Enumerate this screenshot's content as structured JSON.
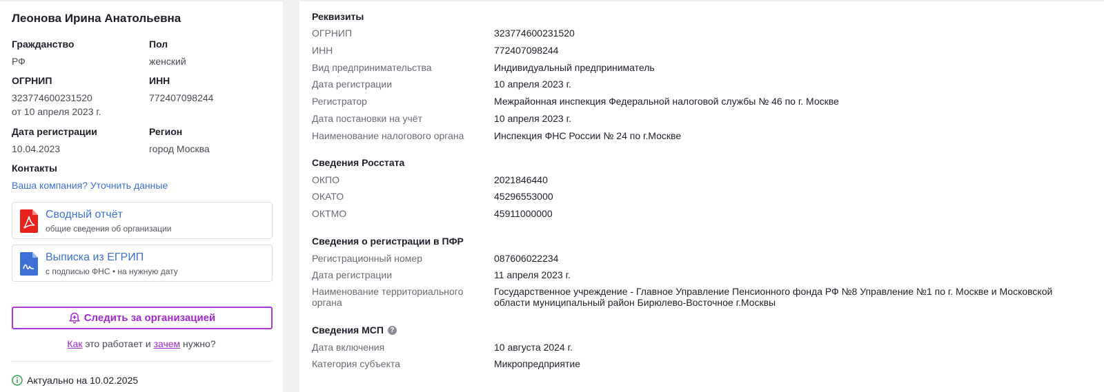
{
  "left": {
    "name": "Леонова Ирина Анатольевна",
    "citizenship": {
      "label": "Гражданство",
      "value": "РФ"
    },
    "gender": {
      "label": "Пол",
      "value": "женский"
    },
    "ogrnip": {
      "label": "ОГРНИП",
      "value": "323774600231520",
      "date": "от 10 апреля 2023 г."
    },
    "inn": {
      "label": "ИНН",
      "value": "772407098244"
    },
    "reg_date": {
      "label": "Дата регистрации",
      "value": "10.04.2023"
    },
    "region": {
      "label": "Регион",
      "value": "город Москва"
    },
    "contacts": {
      "label": "Контакты",
      "link": "Ваша компания? Уточнить данные"
    },
    "cards": [
      {
        "title": "Сводный отчёт",
        "subtitle": "общие сведения об организации",
        "icon": "pdf-icon",
        "color": "#e8231e"
      },
      {
        "title": "Выписка из ЕГРИП",
        "subtitle": "с подписью ФНС • на нужную дату",
        "icon": "document-signature-icon",
        "color": "#3d6fd8"
      }
    ],
    "follow_button": "Следить за организацией",
    "how": {
      "link1": "Как",
      "text1": " это работает и ",
      "link2": "зачем",
      "text2": " нужно?"
    },
    "actual": "Актуально на 10.02.2025",
    "accent": "#a228cc"
  },
  "right": {
    "sections": [
      {
        "title": "Реквизиты",
        "rows": [
          {
            "k": "ОГРНИП",
            "v": "323774600231520"
          },
          {
            "k": "ИНН",
            "v": "772407098244"
          },
          {
            "k": "Вид предпринимательства",
            "v": "Индивидуальный предприниматель"
          },
          {
            "k": "Дата регистрации",
            "v": "10 апреля 2023 г."
          },
          {
            "k": "Регистратор",
            "v": "Межрайонная инспекция Федеральной налоговой службы № 46 по г. Москве"
          },
          {
            "k": "Дата постановки на учёт",
            "v": "10 апреля 2023 г."
          },
          {
            "k": "Наименование налогового органа",
            "v": "Инспекция ФНС России № 24 по г.Москве"
          }
        ]
      },
      {
        "title": "Сведения Росстата",
        "rows": [
          {
            "k": "ОКПО",
            "v": "2021846440"
          },
          {
            "k": "ОКАТО",
            "v": "45296553000"
          },
          {
            "k": "ОКТМО",
            "v": "45911000000"
          }
        ]
      },
      {
        "title": "Сведения о регистрации в ПФР",
        "rows": [
          {
            "k": "Регистрационный номер",
            "v": "087606022234"
          },
          {
            "k": "Дата регистрации",
            "v": "11 апреля 2023 г."
          },
          {
            "k1": "Наименование территориального",
            "k2": "органа",
            "v1": "Государственное учреждение - Главное Управление Пенсионного фонда РФ №8 Управление №1 по г. Москве и Московской",
            "v2": "области муниципальный район Бирюлево-Восточное г.Москвы"
          }
        ]
      },
      {
        "title": "Сведения МСП",
        "help": "?",
        "rows": [
          {
            "k": "Дата включения",
            "v": "10 августа 2024 г."
          },
          {
            "k": "Категория субъекта",
            "v": "Микропредприятие"
          }
        ]
      }
    ]
  }
}
